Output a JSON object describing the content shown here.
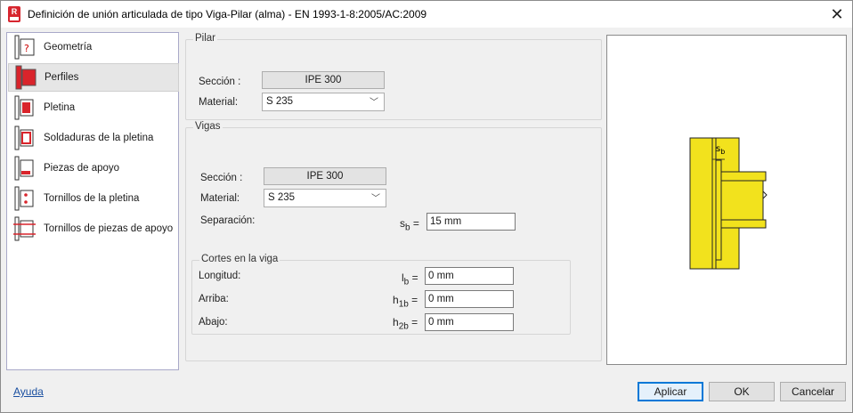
{
  "window": {
    "title": "Definición de unión articulada de tipo Viga-Pilar (alma) - EN 1993-1-8:2005/AC:2009",
    "app_icon_letter": "R",
    "close_glyph": "✕"
  },
  "nav": {
    "items": [
      {
        "label": "Geometría",
        "icon": "geometry-icon"
      },
      {
        "label": "Perfiles",
        "icon": "profiles-icon"
      },
      {
        "label": "Pletina",
        "icon": "plate-icon"
      },
      {
        "label": "Soldaduras de la pletina",
        "icon": "plate-welds-icon"
      },
      {
        "label": "Piezas de apoyo",
        "icon": "support-pieces-icon"
      },
      {
        "label": "Tornillos de la pletina",
        "icon": "plate-bolts-icon"
      },
      {
        "label": "Tornillos de piezas de apoyo",
        "icon": "support-bolts-icon"
      }
    ],
    "selected": "Perfiles"
  },
  "pilar": {
    "group_title": "Pilar",
    "section_label": "Sección :",
    "section_value": "IPE 300",
    "material_label": "Material:",
    "material_value": "S 235"
  },
  "vigas": {
    "group_title": "Vigas",
    "section_label": "Sección :",
    "section_value": "IPE 300",
    "material_label": "Material:",
    "material_value": "S 235",
    "separation_label": "Separación:",
    "separation_symbol": "s",
    "separation_sub": "b",
    "separation_value": "15 mm"
  },
  "cortes": {
    "group_title": "Cortes en la viga",
    "longitud_label": "Longitud:",
    "longitud_symbol": "l",
    "longitud_sub": "b",
    "longitud_value": "0 mm",
    "arriba_label": "Arriba:",
    "arriba_symbol": "h",
    "arriba_sub": "1b",
    "arriba_value": "0 mm",
    "abajo_label": "Abajo:",
    "abajo_symbol": "h",
    "abajo_sub": "2b",
    "abajo_value": "0 mm",
    "equals": "="
  },
  "preview": {
    "dimension_label": "s",
    "dimension_sub": "b",
    "steel_color": "#f2e21d",
    "outline_color": "#222222"
  },
  "footer": {
    "help_link": "Ayuda",
    "apply_button": "Aplicar",
    "ok_button": "OK",
    "cancel_button": "Cancelar"
  },
  "colors": {
    "accent": "#0078d7",
    "selected_icon_red": "#d9242b",
    "link": "#1a4fa0"
  }
}
